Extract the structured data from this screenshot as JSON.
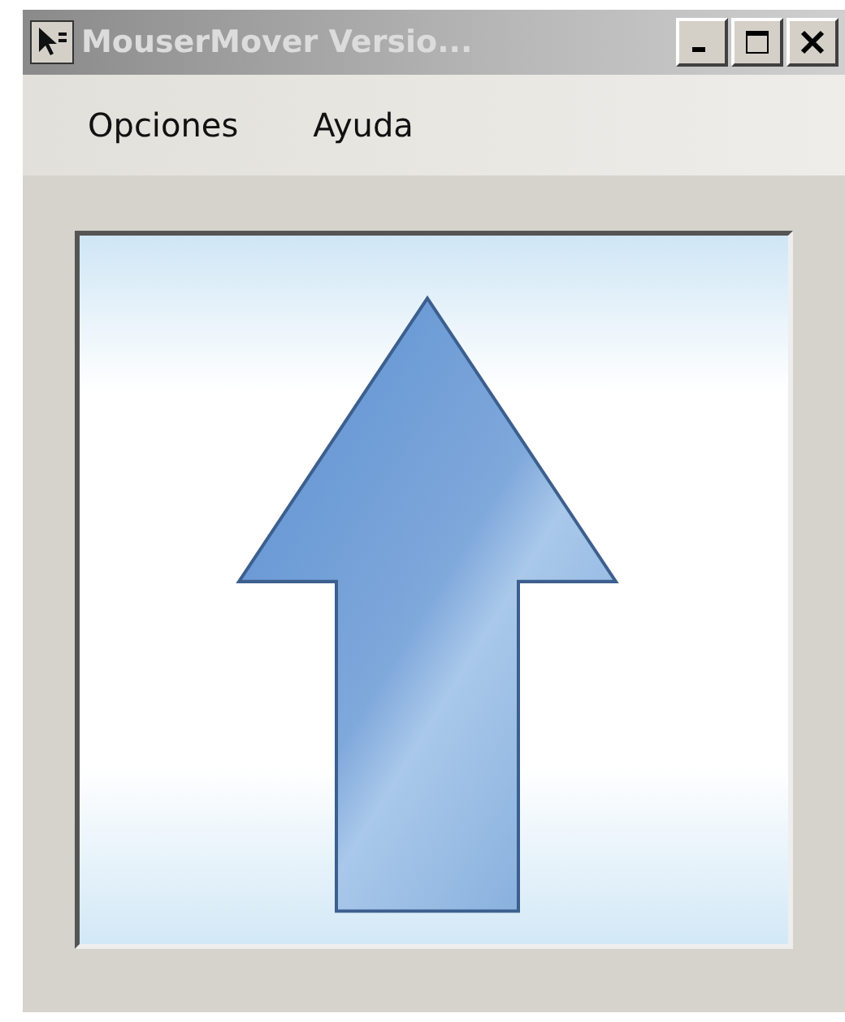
{
  "window": {
    "title": "MouserMover Versio..."
  },
  "menu": [
    {
      "label": "Opciones"
    },
    {
      "label": "Ayuda"
    }
  ]
}
